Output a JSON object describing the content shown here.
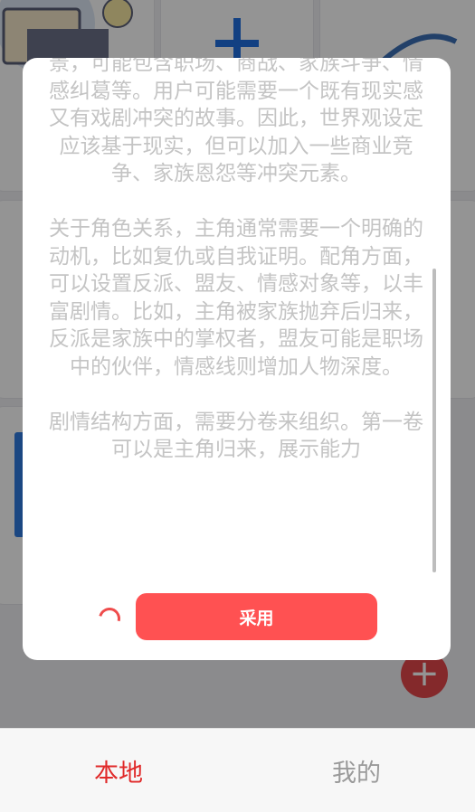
{
  "modal": {
    "paragraphs": [
      "景，可能包含职场、商战、家族斗争、情感纠葛等。用户可能需要一个既有现实感又有戏剧冲突的故事。因此，世界观设定应该基于现实，但可以加入一些商业竞争、家族恩怨等冲突元素。",
      "关于角色关系，主角通常需要一个明确的动机，比如复仇或自我证明。配角方面，可以设置反派、盟友、情感对象等，以丰富剧情。比如，主角被家族抛弃后归来，反派是家族中的掌权者，盟友可能是职场中的伙伴，情感线则增加人物深度。",
      "剧情结构方面，需要分卷来组织。第一卷可以是主角归来，展示能力"
    ],
    "adopt_label": "采用"
  },
  "bottom_nav": {
    "local_label": "本地",
    "mine_label": "我的",
    "active": "local"
  },
  "fab": {
    "icon": "plus-icon",
    "glyph": "+"
  },
  "colors": {
    "accent": "#ff5152",
    "nav_active": "#e02a2a",
    "nav_inactive": "#9a9a9a"
  }
}
